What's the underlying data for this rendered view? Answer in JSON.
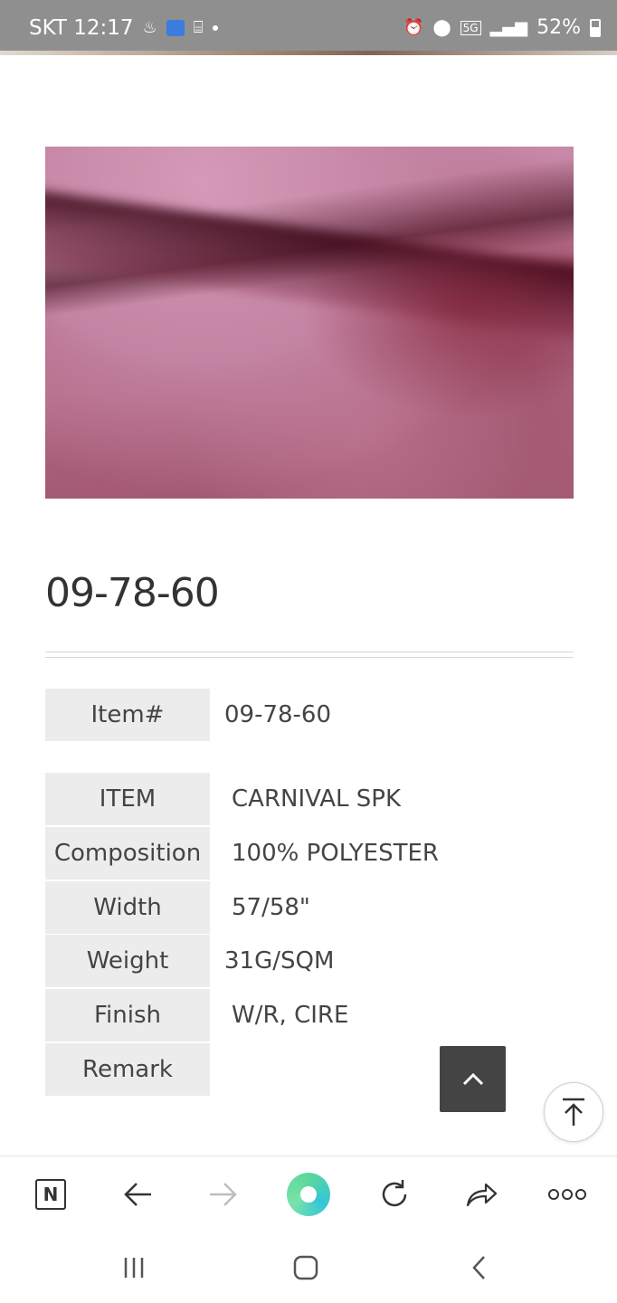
{
  "status_bar": {
    "carrier_time": "SKT 12:17",
    "network": "5G",
    "battery": "52%"
  },
  "product": {
    "title": "09-78-60",
    "item_number_label": "Item#",
    "item_number_value": "09-78-60"
  },
  "specs": [
    {
      "label": "ITEM",
      "value": "CARNIVAL SPK"
    },
    {
      "label": "Composition",
      "value": "100% POLYESTER"
    },
    {
      "label": "Width",
      "value": "57/58\""
    },
    {
      "label": "Weight",
      "value": "31G/SQM"
    },
    {
      "label": "Finish",
      "value": "W/R, CIRE"
    },
    {
      "label": "Remark",
      "value": ""
    }
  ],
  "browser_toolbar": {
    "home_label": "N"
  }
}
